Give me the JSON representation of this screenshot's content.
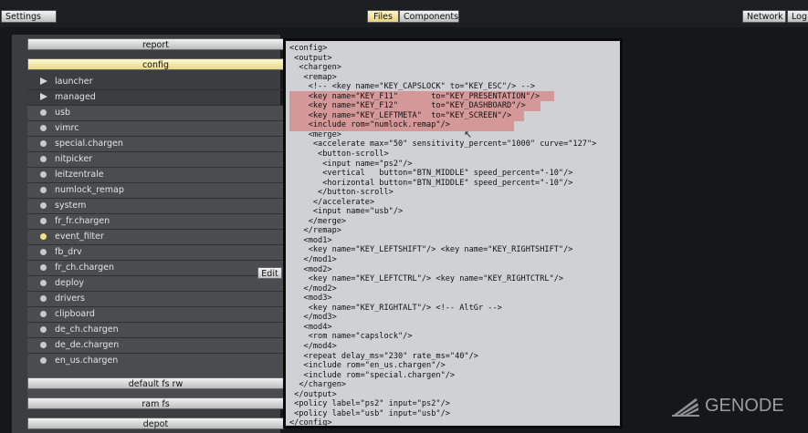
{
  "topbar": {
    "settings": "Settings",
    "files": "Files",
    "components": "Components",
    "network": "Network",
    "log": "Log"
  },
  "left": {
    "report": "report",
    "config": "config",
    "items": [
      {
        "label": "launcher",
        "icon": "triangle"
      },
      {
        "label": "managed",
        "icon": "triangle"
      },
      {
        "label": "usb",
        "icon": "dot"
      },
      {
        "label": "vimrc",
        "icon": "dot"
      },
      {
        "label": "special.chargen",
        "icon": "dot"
      },
      {
        "label": "nitpicker",
        "icon": "dot"
      },
      {
        "label": "leitzentrale",
        "icon": "dot"
      },
      {
        "label": "numlock_remap",
        "icon": "dot"
      },
      {
        "label": "system",
        "icon": "dot"
      },
      {
        "label": "fr_fr.chargen",
        "icon": "dot"
      },
      {
        "label": "event_filter",
        "icon": "dot-yellow"
      },
      {
        "label": "fb_drv",
        "icon": "dot"
      },
      {
        "label": "fr_ch.chargen",
        "icon": "dot"
      },
      {
        "label": "deploy",
        "icon": "dot"
      },
      {
        "label": "drivers",
        "icon": "dot"
      },
      {
        "label": "clipboard",
        "icon": "dot"
      },
      {
        "label": "de_ch.chargen",
        "icon": "dot"
      },
      {
        "label": "de_de.chargen",
        "icon": "dot"
      },
      {
        "label": "en_us.chargen",
        "icon": "dot"
      }
    ],
    "edit": "Edit",
    "default_fs_rw": "default fs rw",
    "ram_fs": "ram fs",
    "depot": "depot"
  },
  "editor": {
    "lines": [
      "<config>",
      " <output>",
      "  <chargen>",
      "   <remap>",
      "    <!-- <key name=\"KEY_CAPSLOCK\" to=\"KEY_ESC\"/> -->",
      "    <key name=\"KEY_F11\"       to=\"KEY_PRESENTATION\"/>",
      "    <key name=\"KEY_F12\"       to=\"KEY_DASHBOARD\"/>",
      "    <key name=\"KEY_LEFTMETA\"  to=\"KEY_SCREEN\"/>",
      "    <include rom=\"numlock.remap\"/>",
      "    <merge>",
      "     <accelerate max=\"50\" sensitivity_percent=\"1000\" curve=\"127\">",
      "      <button-scroll>",
      "       <input name=\"ps2\"/>",
      "       <vertical   button=\"BTN_MIDDLE\" speed_percent=\"-10\"/>",
      "       <horizontal button=\"BTN_MIDDLE\" speed_percent=\"-10\"/>",
      "      </button-scroll>",
      "     </accelerate>",
      "     <input name=\"usb\"/>",
      "    </merge>",
      "   </remap>",
      "   <mod1>",
      "    <key name=\"KEY_LEFTSHIFT\"/> <key name=\"KEY_RIGHTSHIFT\"/>",
      "   </mod1>",
      "   <mod2>",
      "    <key name=\"KEY_LEFTCTRL\"/> <key name=\"KEY_RIGHTCTRL\"/>",
      "   </mod2>",
      "   <mod3>",
      "    <key name=\"KEY_RIGHTALT\"/> <!-- AltGr -->",
      "   </mod3>",
      "   <mod4>",
      "    <rom name=\"capslock\"/>",
      "   </mod4>",
      "   <repeat delay_ms=\"230\" rate_ms=\"40\"/>",
      "   <include rom=\"en_us.chargen\"/>",
      "   <include rom=\"special.chargen\"/>",
      "  </chargen>",
      " </output>",
      " <policy label=\"ps2\" input=\"ps2\"/>",
      " <policy label=\"usb\" input=\"usb\"/>",
      "</config>"
    ],
    "highlight_color": "#d49898"
  },
  "logo": {
    "text": "GENODE"
  }
}
